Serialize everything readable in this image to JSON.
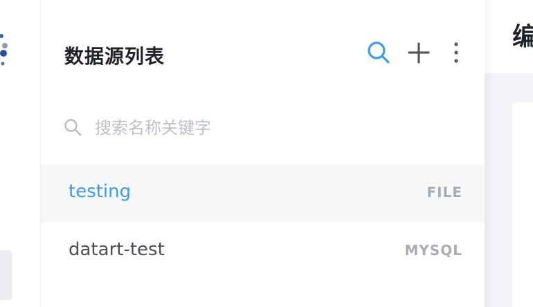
{
  "panel": {
    "title": "数据源列表",
    "search_placeholder": "搜索名称关键字",
    "search_value": ""
  },
  "toolbar": {
    "search_icon": "search-icon",
    "add_icon": "plus-icon",
    "more_icon": "more-vertical-icon"
  },
  "datasources": [
    {
      "name": "testing",
      "type": "FILE",
      "selected": true
    },
    {
      "name": "datart-test",
      "type": "MYSQL",
      "selected": false
    }
  ],
  "right": {
    "title_partial": "编"
  },
  "colors": {
    "accent": "#3f9be6",
    "selected_bg": "#f6f7f9",
    "muted": "#a8adb5",
    "title": "#1f2329"
  }
}
